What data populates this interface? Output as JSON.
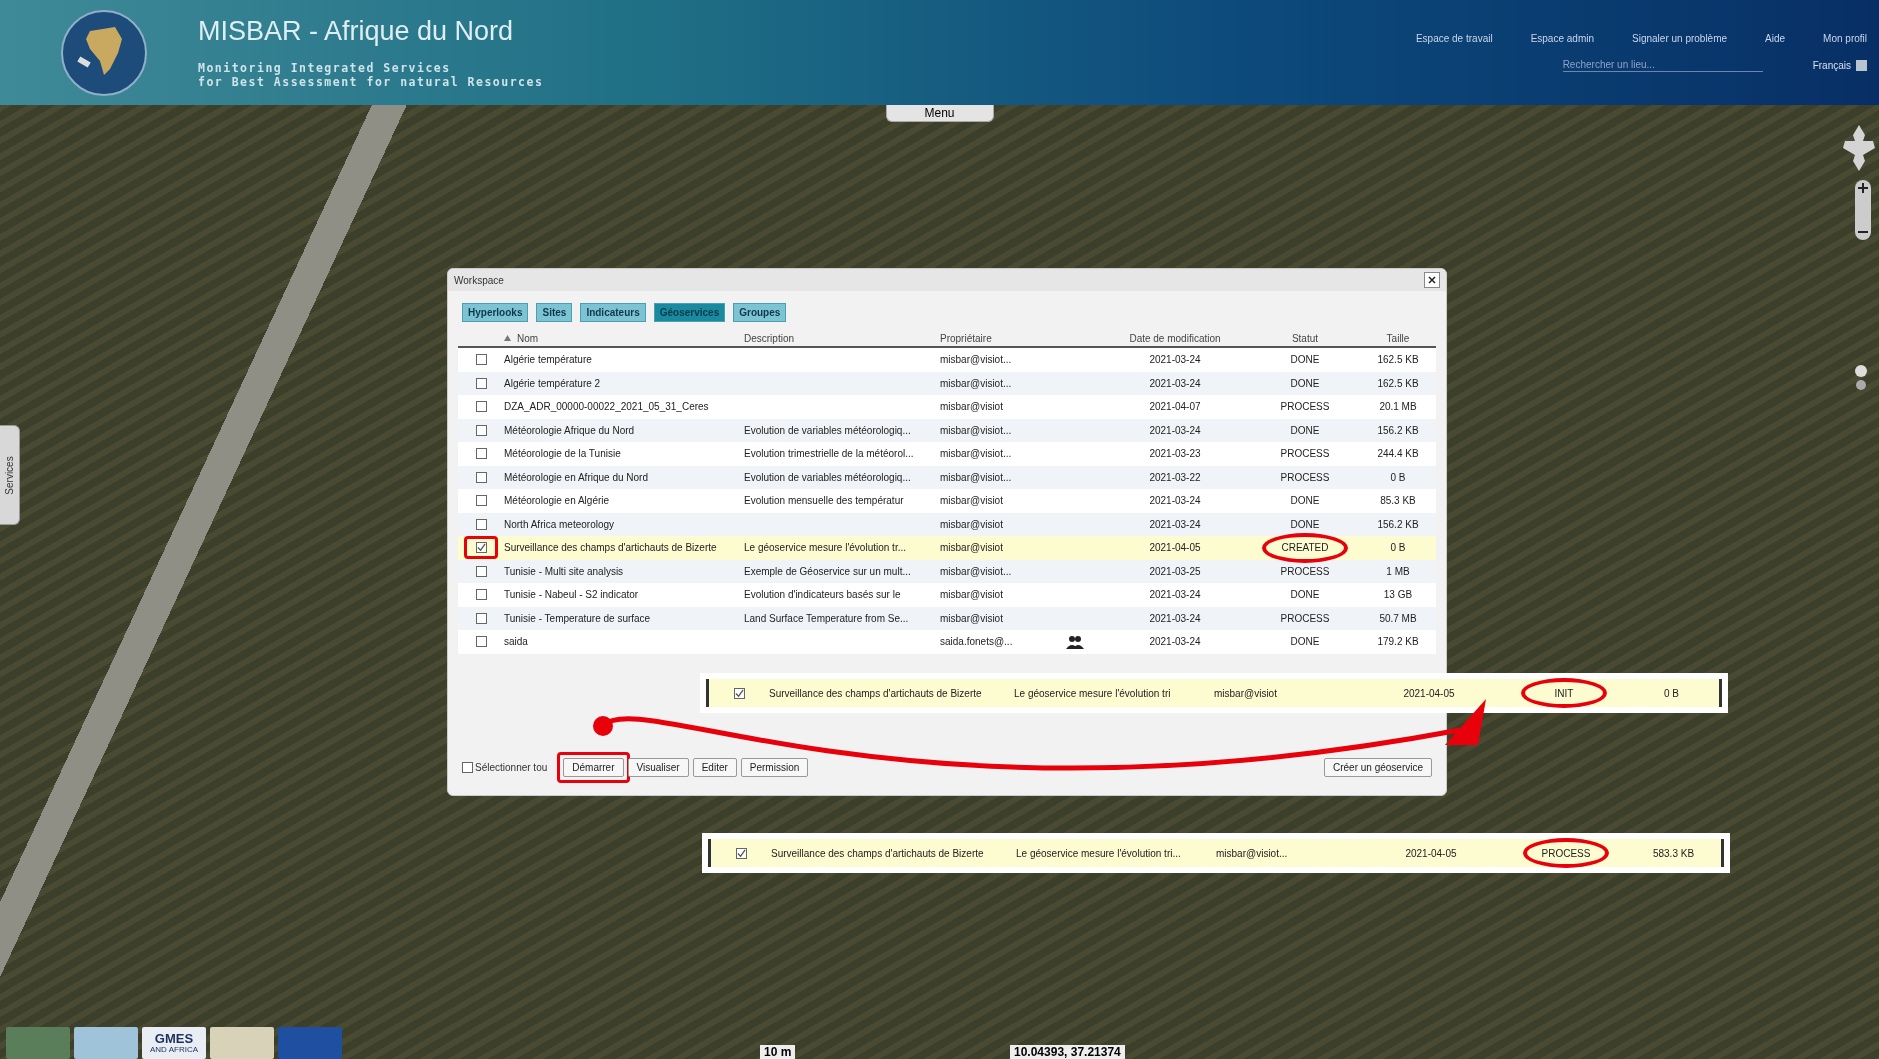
{
  "header": {
    "title": "MISBAR - Afrique du Nord",
    "subtitle": [
      "Monitoring Integrated Services",
      "for Best Assessment for natural Resources"
    ],
    "nav": [
      "Espace de travail",
      "Espace admin",
      "Signaler un problème",
      "Aide",
      "Mon profil"
    ],
    "search": {
      "placeholder": "Rechercher un lieu..."
    },
    "language": "Français"
  },
  "map": {
    "menu_tab": "Menu",
    "side_tab": "Services",
    "scale": "10 m",
    "coordinates": "10.04393, 37.21374",
    "logos": [
      {
        "kind": "eye"
      },
      {
        "kind": "badge"
      },
      {
        "kind": "gmes",
        "text": "GMES",
        "subtext": "AND AFRICA"
      },
      {
        "kind": "union"
      },
      {
        "kind": "flag"
      }
    ]
  },
  "dialog": {
    "title": "Workspace",
    "tabs": [
      {
        "label": "Hyperlooks",
        "selected": false
      },
      {
        "label": "Sites",
        "selected": false
      },
      {
        "label": "Indicateurs",
        "selected": false
      },
      {
        "label": "Géoservices",
        "selected": true
      },
      {
        "label": "Groupes",
        "selected": false
      }
    ],
    "columns": [
      {
        "label": "Nom",
        "sorted": true
      },
      {
        "label": "Description",
        "sorted": false
      },
      {
        "label": "Propriétaire",
        "sorted": false
      },
      {
        "label": "Date de modification",
        "sorted": false
      },
      {
        "label": "Statut",
        "sorted": false
      },
      {
        "label": "Taille",
        "sorted": false
      }
    ],
    "rows": [
      {
        "name": "Algérie température",
        "description": "",
        "owner": "misbar@visiot...",
        "shared": false,
        "date": "2021-03-24",
        "status": "DONE",
        "size": "162.5 KB",
        "checked": false,
        "selected": false,
        "circled": false,
        "boxed": false
      },
      {
        "name": "Algérie température 2",
        "description": "",
        "owner": "misbar@visiot...",
        "shared": false,
        "date": "2021-03-24",
        "status": "DONE",
        "size": "162.5 KB",
        "checked": false,
        "selected": false,
        "circled": false,
        "boxed": false
      },
      {
        "name": "DZA_ADR_00000-00022_2021_05_31_Ceres",
        "description": "",
        "owner": "misbar@visiot",
        "shared": false,
        "date": "2021-04-07",
        "status": "PROCESS",
        "size": "20.1 MB",
        "checked": false,
        "selected": false,
        "circled": false,
        "boxed": false
      },
      {
        "name": "Météorologie Afrique du Nord",
        "description": "Evolution de variables météorologiq...",
        "owner": "misbar@visiot...",
        "shared": false,
        "date": "2021-03-24",
        "status": "DONE",
        "size": "156.2 KB",
        "checked": false,
        "selected": false,
        "circled": false,
        "boxed": false
      },
      {
        "name": "Météorologie de la Tunisie",
        "description": "Evolution trimestrielle de la météorol...",
        "owner": "misbar@visiot...",
        "shared": false,
        "date": "2021-03-23",
        "status": "PROCESS",
        "size": "244.4 KB",
        "checked": false,
        "selected": false,
        "circled": false,
        "boxed": false
      },
      {
        "name": "Météorologie en Afrique du Nord",
        "description": "Evolution de variables météorologiq...",
        "owner": "misbar@visiot...",
        "shared": false,
        "date": "2021-03-22",
        "status": "PROCESS",
        "size": "0 B",
        "checked": false,
        "selected": false,
        "circled": false,
        "boxed": false
      },
      {
        "name": "Météorologie en Algérie",
        "description": "Evolution mensuelle des températur",
        "owner": "misbar@visiot",
        "shared": false,
        "date": "2021-03-24",
        "status": "DONE",
        "size": "85.3 KB",
        "checked": false,
        "selected": false,
        "circled": false,
        "boxed": false
      },
      {
        "name": "North Africa meteorology",
        "description": "",
        "owner": "misbar@visiot",
        "shared": false,
        "date": "2021-03-24",
        "status": "DONE",
        "size": "156.2 KB",
        "checked": false,
        "selected": false,
        "circled": false,
        "boxed": false
      },
      {
        "name": "Surveillance des champs d'artichauts de Bizerte",
        "description": "Le géoservice mesure l'évolution tr...",
        "owner": "misbar@visiot",
        "shared": false,
        "date": "2021-04-05",
        "status": "CREATED",
        "size": "0 B",
        "checked": true,
        "selected": true,
        "circled": true,
        "boxed": true
      },
      {
        "name": "Tunisie - Multi site analysis",
        "description": "Exemple de Géoservice sur un mult...",
        "owner": "misbar@visiot...",
        "shared": false,
        "date": "2021-03-25",
        "status": "PROCESS",
        "size": "1 MB",
        "checked": false,
        "selected": false,
        "circled": false,
        "boxed": false
      },
      {
        "name": "Tunisie - Nabeul - S2 indicator",
        "description": "Evolution d'indicateurs basés sur le",
        "owner": "misbar@visiot",
        "shared": false,
        "date": "2021-03-24",
        "status": "DONE",
        "size": "13 GB",
        "checked": false,
        "selected": false,
        "circled": false,
        "boxed": false
      },
      {
        "name": "Tunisie - Temperature de surface",
        "description": "Land Surface Temperature from Se...",
        "owner": "misbar@visiot",
        "shared": false,
        "date": "2021-03-24",
        "status": "PROCESS",
        "size": "50.7 MB",
        "checked": false,
        "selected": false,
        "circled": false,
        "boxed": false
      },
      {
        "name": "saida",
        "description": "",
        "owner": "saida.fonets@...",
        "shared": true,
        "date": "2021-03-24",
        "status": "DONE",
        "size": "179.2 KB",
        "checked": false,
        "selected": false,
        "circled": false,
        "boxed": false
      }
    ],
    "select_all": {
      "label": "Sélectionner tou",
      "checked": false
    },
    "actions": [
      {
        "label": "Démarrer",
        "boxed": true
      },
      {
        "label": "Visualiser",
        "boxed": false
      },
      {
        "label": "Editer",
        "boxed": false
      },
      {
        "label": "Permission",
        "boxed": false
      }
    ],
    "create_button": "Créer un géoservice"
  },
  "strips": [
    {
      "checked": true,
      "name": "Surveillance des champs d'artichauts de Bizerte",
      "description": "Le géoservice mesure l'évolution tri",
      "owner": "misbar@visiot",
      "date": "2021-04-05",
      "status": "INIT",
      "size": "0 B",
      "circled": true
    },
    {
      "checked": true,
      "name": "Surveillance des champs d'artichauts de Bizerte",
      "description": "Le géoservice mesure l'évolution tri...",
      "owner": "misbar@visiot...",
      "date": "2021-04-05",
      "status": "PROCESS",
      "size": "583.3 KB",
      "circled": true
    }
  ]
}
